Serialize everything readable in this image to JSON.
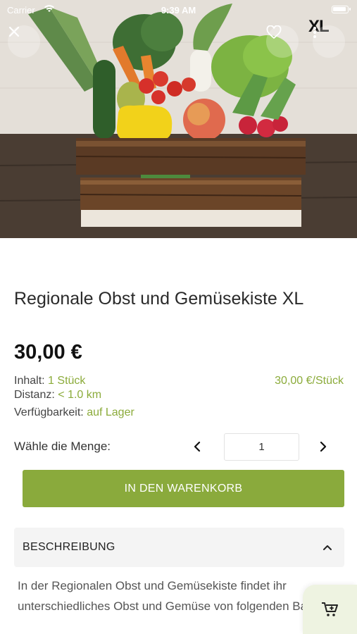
{
  "status_bar": {
    "carrier": "Carrier",
    "time": "9:39 AM"
  },
  "hero": {
    "badge": "XL"
  },
  "product": {
    "title": "Regionale Obst und Gemüsekiste XL",
    "price": "30,00 €",
    "inhalt_label": "Inhalt:",
    "inhalt_value": "1 Stück",
    "unit_price": "30,00 €/Stück",
    "distanz_label": "Distanz:",
    "distanz_value": "< 1.0 km",
    "verfuegbarkeit_label": "Verfügbarkeit:",
    "verfuegbarkeit_value": "auf Lager"
  },
  "quantity": {
    "label": "Wähle die Menge:",
    "value": "1"
  },
  "cart_button": {
    "label": "IN DEN WARENKORB"
  },
  "description": {
    "header": "BESCHREIBUNG",
    "text": "In der Regionalen Obst und Gemüsekiste findet ihr unterschiedliches Obst und Gemüse von folgenden Bauern:"
  },
  "colors": {
    "accent": "#8aaa3c",
    "accent_text": "#8bab3a"
  },
  "icons": {
    "close": "close-icon",
    "favorite": "heart-icon",
    "more": "more-vertical-icon",
    "prev": "chevron-left-icon",
    "next": "chevron-right-icon",
    "collapse": "chevron-up-icon",
    "cart": "add-to-cart-icon"
  }
}
